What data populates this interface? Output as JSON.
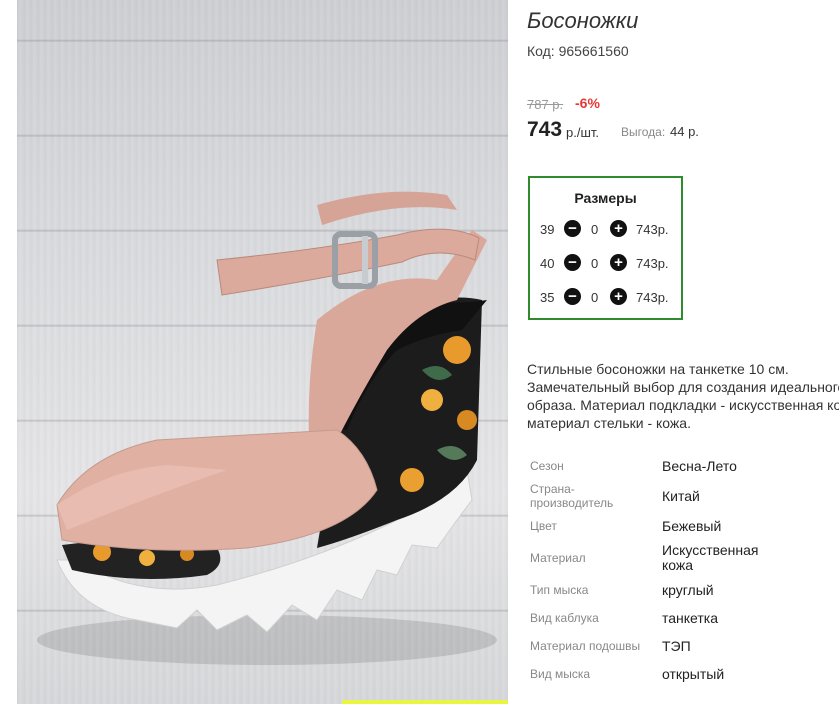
{
  "product": {
    "title": "Босоножки",
    "code": "Код: 965661560",
    "old_price": "787 р.",
    "discount": "-6%",
    "price": "743",
    "price_unit": "р./шт.",
    "benefit_label": "Выгода:",
    "benefit_value": "44 р."
  },
  "sizes": {
    "title": "Размеры",
    "rows": [
      {
        "size": "39",
        "qty": "0",
        "price": "743р."
      },
      {
        "size": "40",
        "qty": "0",
        "price": "743р."
      },
      {
        "size": "35",
        "qty": "0",
        "price": "743р."
      }
    ]
  },
  "description": [
    "Стильные босоножки на танкетке 10 см.",
    "Замечательный выбор для создания идеального",
    "образа. Материал подкладки - искусственная кожа,",
    "материал стельки - кожа."
  ],
  "attributes": [
    {
      "label": "Сезон",
      "value": "Весна-Лето"
    },
    {
      "label": "Страна-производитель",
      "value": "Китай"
    },
    {
      "label": "Цвет",
      "value": "Бежевый"
    },
    {
      "label": "Материал",
      "value": "Искусственная кожа"
    },
    {
      "label": "Тип мыска",
      "value": "круглый"
    },
    {
      "label": "Вид каблука",
      "value": "танкетка"
    },
    {
      "label": "Материал подошвы",
      "value": "ТЭП"
    },
    {
      "label": "Вид мыска",
      "value": "открытый"
    }
  ],
  "colors": {
    "sizes_border": "#2e8b2e",
    "discount": "#e53935",
    "highlight_bar": "#e8f542"
  }
}
